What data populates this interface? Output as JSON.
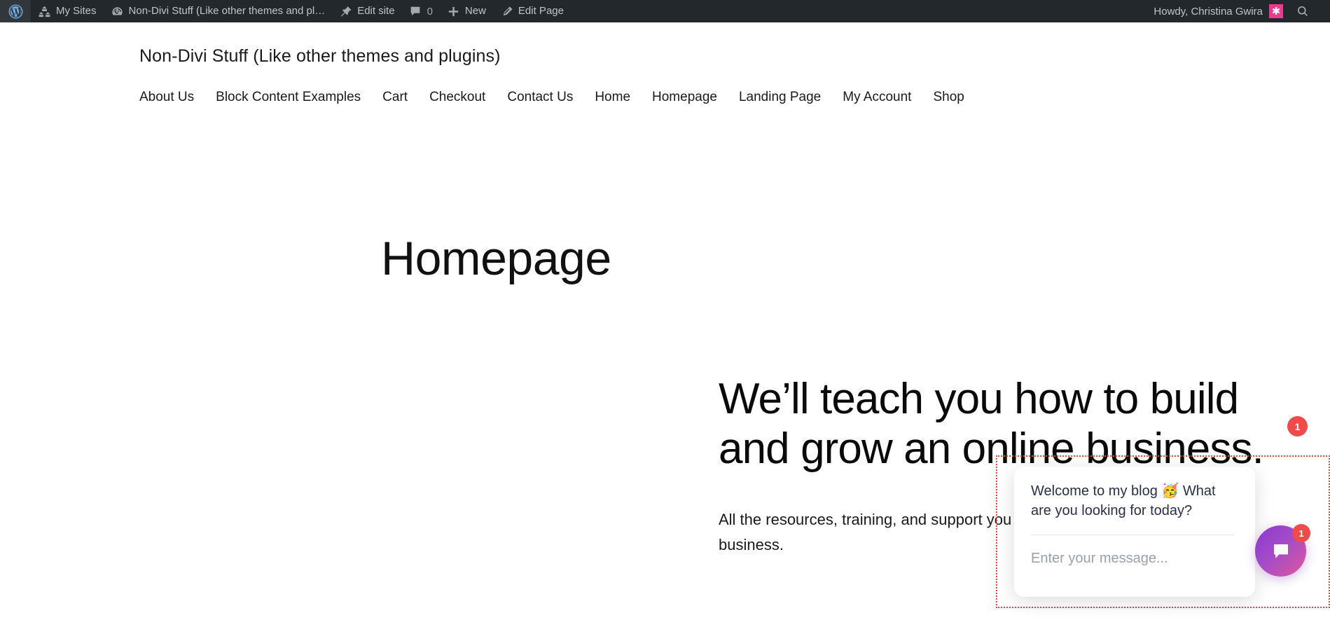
{
  "admin_bar": {
    "logo_icon": "wordpress-logo-icon",
    "items": [
      {
        "label": "My Sites",
        "icon": "my-sites-icon"
      },
      {
        "label": "Non-Divi Stuff (Like other themes and pl…",
        "icon": "dashboard-gauge-icon"
      },
      {
        "label": "Edit site",
        "icon": "pushpin-icon"
      },
      {
        "label": "0",
        "icon": "comment-bubble-icon",
        "is_count": true
      },
      {
        "label": "New",
        "icon": "plus-icon"
      },
      {
        "label": "Edit Page",
        "icon": "pencil-icon"
      }
    ],
    "howdy": "Howdy, Christina Gwira",
    "avatar_glyph": "✱",
    "avatar_color": "#ee3a8c",
    "search_icon": "search-icon",
    "background_color": "#23282d"
  },
  "site": {
    "title": "Non-Divi Stuff (Like other themes and plugins)",
    "nav": [
      "About Us",
      "Block Content Examples",
      "Cart",
      "Checkout",
      "Contact Us",
      "Home",
      "Homepage",
      "Landing Page",
      "My Account",
      "Shop"
    ]
  },
  "page": {
    "title": "Homepage",
    "hero_heading": "We’ll teach you how to build and grow an online business.",
    "hero_subtext": "All the resources, training, and support you need to run your dream online business."
  },
  "floating_badge": {
    "count": "1",
    "color": "#ef4b4b"
  },
  "chat_widget": {
    "greeting": "Welcome to my blog 🥳\nWhat are you looking for today?",
    "input_placeholder": "Enter your message...",
    "fab_icon": "chat-bubble-icon",
    "fab_badge_count": "1",
    "fab_gradient_start": "#8c38d0",
    "fab_gradient_end": "#e0579c",
    "badge_color": "#ef4b4b",
    "selection_outline_color": "#e8453c"
  }
}
